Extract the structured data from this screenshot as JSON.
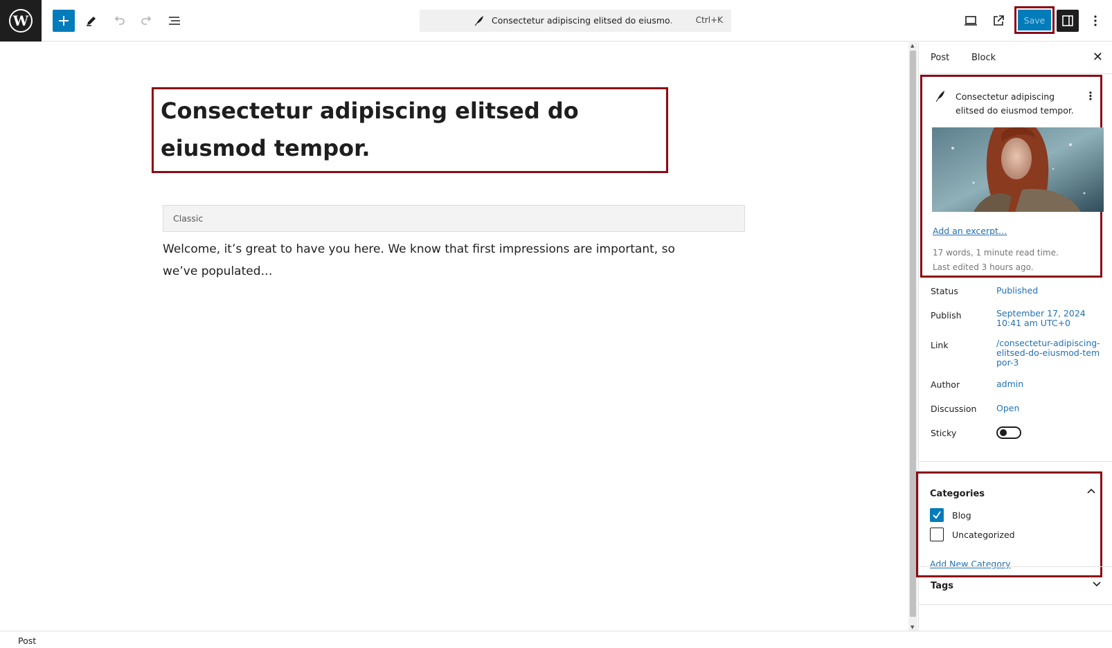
{
  "toolbar": {
    "command_title": "Consectetur adipiscing elitsed do eiusmo…",
    "shortcut": "Ctrl+K",
    "save_label": "Save"
  },
  "editor": {
    "post_title": "Consectetur adipiscing elitsed do eiusmod tempor.",
    "block_label": "Classic",
    "body_text": "Welcome, it’s great to have you here. We know that first impressions are important, so we’ve populated…"
  },
  "footer": {
    "breadcrumb": "Post"
  },
  "sidebar": {
    "tabs": [
      {
        "label": "Post"
      },
      {
        "label": "Block"
      }
    ],
    "summary": {
      "title": "Consectetur adipiscing elitsed do eiusmod tempor.",
      "excerpt_link": "Add an excerpt…",
      "word_count": "17 words, 1 minute read time.",
      "last_edited": "Last edited 3 hours ago."
    },
    "fields": {
      "status": {
        "label": "Status",
        "value": "Published"
      },
      "publish": {
        "label": "Publish",
        "value": "September 17, 2024 10:41 am UTC+0"
      },
      "link": {
        "label": "Link",
        "value": "/consectetur-adipiscing-elitsed-do-eiusmod-tempor-3"
      },
      "author": {
        "label": "Author",
        "value": "admin"
      },
      "discussion": {
        "label": "Discussion",
        "value": "Open"
      },
      "sticky": {
        "label": "Sticky",
        "checked": false
      }
    },
    "categories": {
      "title": "Categories",
      "items": [
        {
          "label": "Blog",
          "checked": true
        },
        {
          "label": "Uncategorized",
          "checked": false
        }
      ],
      "add_link": "Add New Category"
    },
    "tags": {
      "title": "Tags"
    }
  },
  "colors": {
    "accent": "#007cba",
    "link": "#2271b1",
    "highlight_border": "#8b0a14"
  }
}
